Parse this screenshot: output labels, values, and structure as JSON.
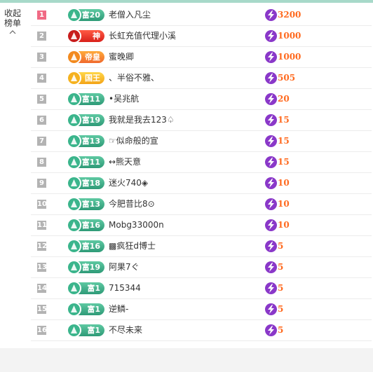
{
  "collapse": {
    "label": "收起榜单",
    "icon": "chevron-up-icon"
  },
  "icons": {
    "badge": "level-badge-icon",
    "score": "lightning-icon"
  },
  "colors": {
    "rank_first": "#f06a84",
    "rank_other": "#b3b3b3",
    "score": "#ff6a1f",
    "topbar": "#a7d9c9"
  },
  "rows": [
    {
      "rank": "1",
      "level": "富20",
      "tier": "green",
      "name": "老僧入凡尘",
      "score": "3200"
    },
    {
      "rank": "2",
      "level": "神",
      "tier": "red",
      "name": "长虹充值代理小溪",
      "score": "1000"
    },
    {
      "rank": "3",
      "level": "帝皇",
      "tier": "orange",
      "name": "蜜晚卿",
      "score": "1000"
    },
    {
      "rank": "4",
      "level": "国王",
      "tier": "gold",
      "name": "、半俗不雅、",
      "score": "505"
    },
    {
      "rank": "5",
      "level": "富11",
      "tier": "green",
      "name": "•吴兆航",
      "score": "20"
    },
    {
      "rank": "6",
      "level": "富19",
      "tier": "green",
      "name": "我就是我去123♤",
      "score": "15"
    },
    {
      "rank": "7",
      "level": "富13",
      "tier": "green",
      "name": "☞似命般的宣",
      "score": "15"
    },
    {
      "rank": "8",
      "level": "富11",
      "tier": "green",
      "name": "↔熊天意",
      "score": "15"
    },
    {
      "rank": "9",
      "level": "富18",
      "tier": "green",
      "name": "迷火740◈",
      "score": "10"
    },
    {
      "rank": "10",
      "level": "富13",
      "tier": "green",
      "name": "今肥昔比8⊙",
      "score": "10"
    },
    {
      "rank": "11",
      "level": "富16",
      "tier": "green",
      "name": "Mobg33000n",
      "score": "10"
    },
    {
      "rank": "12",
      "level": "富16",
      "tier": "green",
      "name": "▩疯狂d博士",
      "score": "5"
    },
    {
      "rank": "13",
      "level": "富19",
      "tier": "green",
      "name": "阿果7ぐ",
      "score": "5"
    },
    {
      "rank": "14",
      "level": "富1",
      "tier": "green",
      "name": "715344",
      "score": "5"
    },
    {
      "rank": "15",
      "level": "富1",
      "tier": "green",
      "name": "逆鳞-",
      "score": "5"
    },
    {
      "rank": "16",
      "level": "富1",
      "tier": "green",
      "name": "不尽未来",
      "score": "5"
    }
  ]
}
